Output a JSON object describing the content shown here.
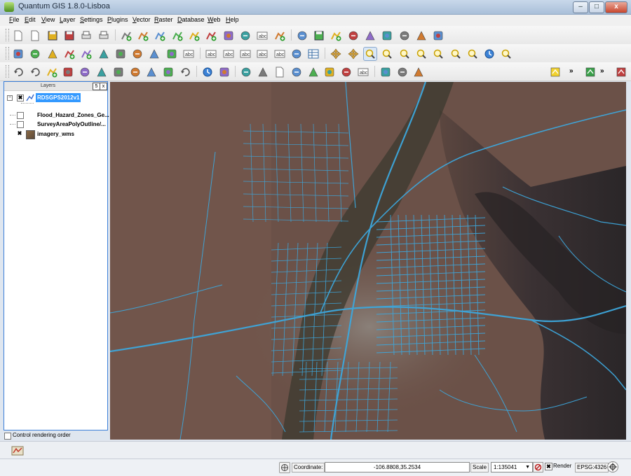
{
  "window": {
    "title": "Quantum GIS 1.8.0-Lisboa",
    "minimize": "–",
    "maximize": "□",
    "close": "x"
  },
  "menu": [
    "File",
    "Edit",
    "View",
    "Layer",
    "Settings",
    "Plugins",
    "Vector",
    "Raster",
    "Database",
    "Web",
    "Help"
  ],
  "layers_panel": {
    "title": "Layers",
    "float_button": "5",
    "close_button": "x",
    "layers": [
      {
        "name": "RDSGPS2012v1",
        "checked": true,
        "selected": true,
        "expanded": true
      },
      {
        "name": "Flood_Hazard_Zones_Ge...",
        "checked": false,
        "selected": false
      },
      {
        "name": "SurveyAreaPolyOutline/...",
        "checked": false,
        "selected": false
      },
      {
        "name": "imagery_wms",
        "checked": true,
        "selected": false
      }
    ]
  },
  "control_rendering_order": "Control rendering order",
  "statusbar": {
    "coordinate_label": "Coordinate:",
    "coordinate_value": "-106.8808,35.2534",
    "scale_label": "Scale",
    "scale_value": "1:135041",
    "render_label": "Render",
    "crs": "EPSG:4326"
  },
  "colors": {
    "road_lines": "#3da7dc",
    "imagery_base": "#6c5449",
    "mountain_dark": "#2f2a2c",
    "selection": "#3399ff"
  },
  "icons": {
    "toolbar_row1": [
      "new-project-icon",
      "open-project-icon",
      "save-project-icon",
      "save-as-icon",
      "new-print-composer-icon",
      "print-icon",
      "add-vector-icon",
      "add-raster-icon",
      "add-postgis-icon",
      "add-spatialite-icon",
      "add-wms-icon",
      "add-wfs-icon",
      "new-shapefile-icon",
      "remove-layer-icon",
      "add-delimited-text-icon",
      "add-oracle-icon",
      "toggle-editing-icon",
      "save-edits-icon",
      "add-feature-icon",
      "move-feature-icon",
      "node-tool-icon",
      "delete-selected-icon",
      "cut-features-icon",
      "copy-features-icon",
      "paste-features-icon"
    ],
    "toolbar_row2": [
      "manage-plugins-icon",
      "python-console-icon",
      "merge-layers-icon",
      "add-part-icon",
      "add-ring-icon",
      "rotate-icon",
      "simplify-icon",
      "reshape-icon",
      "split-features-icon",
      "offset-curve-icon",
      "label-icon",
      "pin-labels-icon",
      "show-hide-labels-icon",
      "move-label-icon",
      "rotate-label-icon",
      "change-label-icon",
      "highlight-pin-icon",
      "layer-properties-icon",
      "pan-icon",
      "pan-to-selection-icon",
      "zoom-in-icon",
      "zoom-out-icon",
      "zoom-full-icon",
      "zoom-to-selection-icon",
      "zoom-to-layer-icon",
      "zoom-last-icon",
      "zoom-next-icon",
      "refresh-icon",
      "magnifier-icon"
    ],
    "toolbar_row3": [
      "undo-icon",
      "redo-icon",
      "add-circular-string-icon",
      "fill-ring-icon",
      "delete-ring-icon",
      "delete-part-icon",
      "split-parts-icon",
      "node-tool-2-icon",
      "measure-angle-icon",
      "digitize-curve-icon",
      "redo-2-icon",
      "identify-icon",
      "action-icon",
      "select-features-icon",
      "deselect-icon",
      "open-attribute-table-icon",
      "measure-line-icon",
      "map-tips-icon",
      "new-bookmark-icon",
      "show-bookmarks-icon",
      "text-annotation-icon",
      "numerical-digitize-icon",
      "georeferencer-icon",
      "tile-scale-icon"
    ],
    "bottom": "overview-icon",
    "statusbar": [
      "projection-icon",
      "render-checkbox-icon",
      "stop-render-icon",
      "crs-status-icon"
    ]
  }
}
